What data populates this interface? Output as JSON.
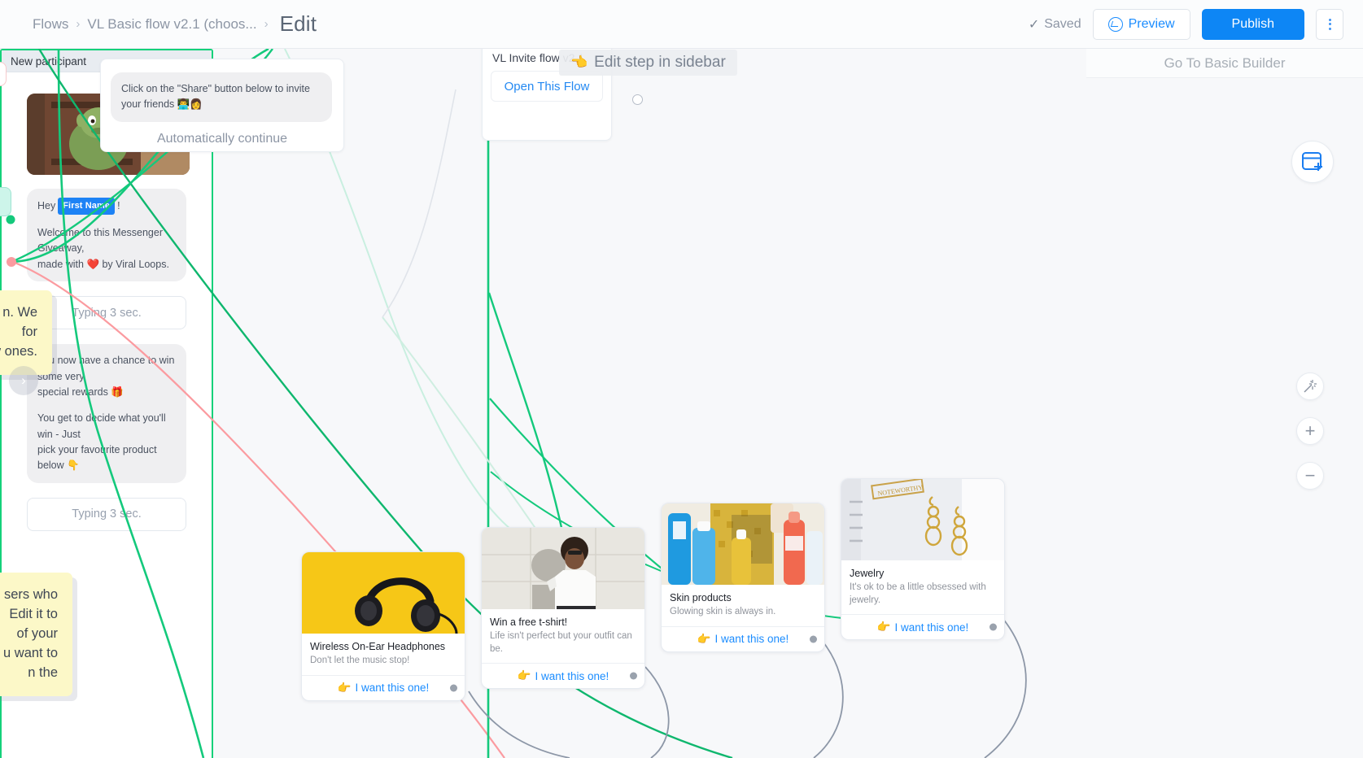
{
  "header": {
    "breadcrumb": [
      {
        "label": "Flows"
      },
      {
        "label": "VL Basic flow v2.1 (choos..."
      },
      {
        "label": "Edit"
      }
    ],
    "separator": "›",
    "saved_label": "Saved",
    "saved_check": "✓",
    "preview_label": "Preview",
    "publish_label": "Publish",
    "kebab_name": "more-options",
    "accent_blue": "#0d86f5",
    "muted_gray": "#8d96a5"
  },
  "secondary_bar": {
    "go_to_basic_builder": "Go To Basic Builder"
  },
  "tooltip": {
    "text": "Edit step in sidebar",
    "icon": "pointing-hand-emoji",
    "icon_glyph": "👈"
  },
  "nodes": {
    "share_node": {
      "bubble_text": "Click on the \"Share\" button below to invite your friends 👨‍💻👩",
      "auto_continue_label": "Automatically continue"
    },
    "invite_flow_node": {
      "title": "VL Invite flow v2.1",
      "open_flow_label": "Open This Flow"
    },
    "main_node": {
      "header_title": "New participant",
      "image_alt": "shrek-door-gif",
      "greeting_prefix": "Hey",
      "greeting_chip": "First Name",
      "greeting_suffix": "!",
      "welcome_line_1": "Welcome to this Messenger Giveaway,",
      "welcome_line_2": "made with ❤️ by Viral Loops.",
      "typing_1": "Typing 3 sec.",
      "rewards_line_1": "You now have a chance to win some very",
      "rewards_line_2": "special rewards 🎁",
      "rewards_line_3": "You get to decide what you'll win - Just",
      "rewards_line_4": "pick your favourite product below 👇",
      "typing_2": "Typing 3 sec."
    }
  },
  "gallery_cards": [
    {
      "id": "headphones",
      "title": "Wireless On-Ear Headphones",
      "subtitle": "Don't let the music stop!",
      "button_label": "I want this one!",
      "button_icon": "👉",
      "image_alt": "black-headphones-on-yellow"
    },
    {
      "id": "tshirt",
      "title": "Win a free t-shirt!",
      "subtitle": "Life isn't perfect but your outfit can be.",
      "button_label": "I want this one!",
      "button_icon": "👉",
      "image_alt": "man-in-white-tshirt"
    },
    {
      "id": "skin",
      "title": "Skin products",
      "subtitle": "Glowing skin is always in.",
      "button_label": "I want this one!",
      "button_icon": "👉",
      "image_alt": "skincare-bottles"
    },
    {
      "id": "jewelry",
      "title": "Jewelry",
      "subtitle": "It's ok to be a little obsessed with jewelry.",
      "button_label": "I want this one!",
      "button_icon": "👉",
      "image_alt": "gold-earrings-on-notebook"
    }
  ],
  "sticky_notes": [
    {
      "id": "note-top",
      "lines": [
        "n. We",
        "for",
        "w ones."
      ],
      "next_glyph": "›"
    },
    {
      "id": "note-bottom",
      "lines": [
        "sers who",
        "Edit it to",
        "of your",
        "u want to",
        "n the"
      ]
    }
  ],
  "controls": {
    "add_step_icon": "add-card-icon",
    "magic_icon": "magic-wand-icon",
    "zoom_in_icon": "+",
    "zoom_out_icon": "−"
  },
  "colors": {
    "selection_green": "#14d17a",
    "wire_green": "#14c97c",
    "wire_pink": "#fb9ba0",
    "wire_gray": "#8d97a7",
    "canvas_bg": "#f7f8fa",
    "sticky_yellow": "#fcf8c8"
  }
}
